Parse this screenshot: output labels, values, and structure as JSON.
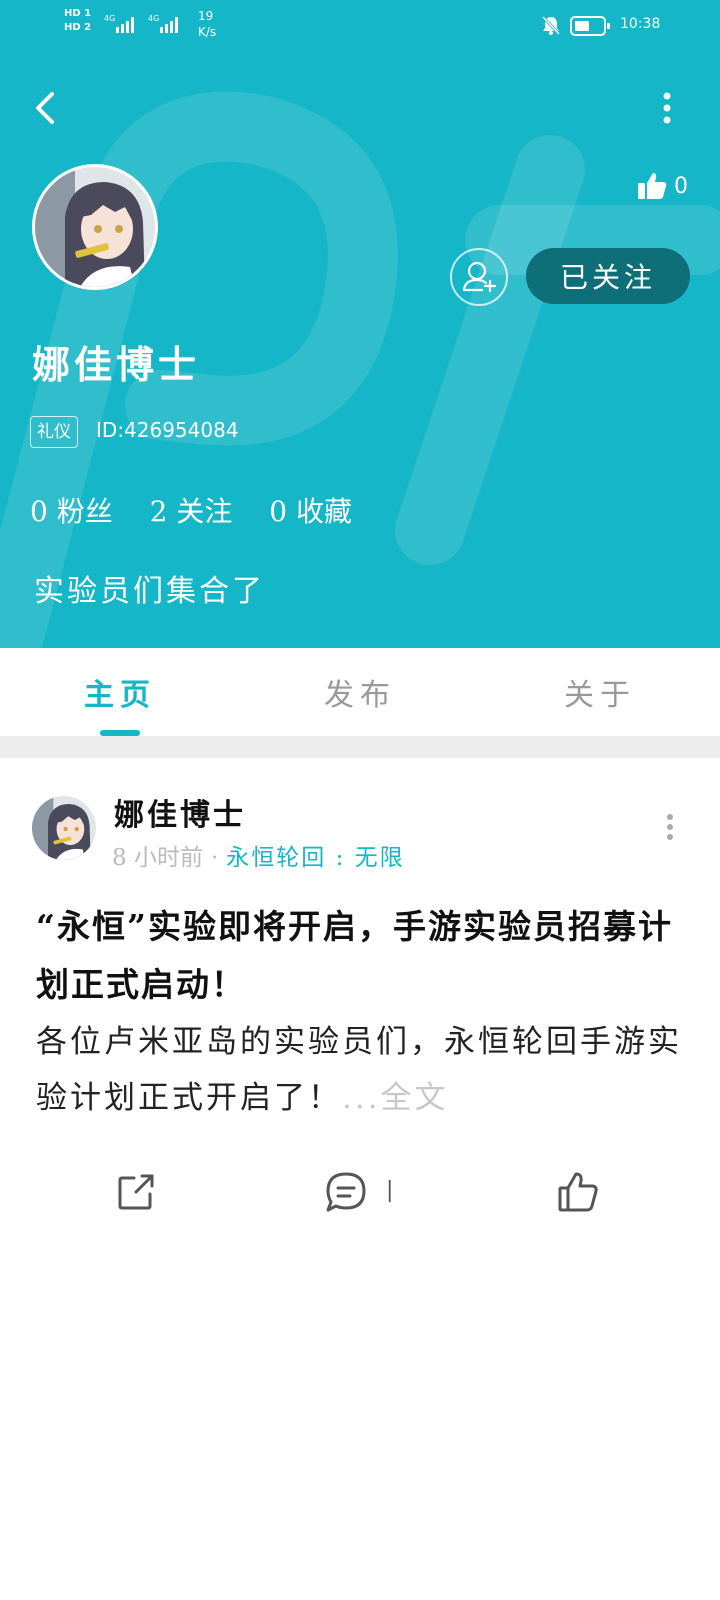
{
  "status_bar": {
    "network_1": "HD 1",
    "network_2": "HD 2",
    "signal_1": "4G",
    "signal_2": "4G",
    "speed_value": "19",
    "speed_unit": "K/s",
    "time": "10:38"
  },
  "profile": {
    "likes": "0",
    "follow_button": "已关注",
    "name": "娜佳博士",
    "tag": "礼仪",
    "id_text": "ID:426954084",
    "stats": {
      "fans": "0 粉丝",
      "following": "2 关注",
      "favorites": "0 收藏"
    },
    "bio": "实验员们集合了"
  },
  "tabs": [
    {
      "label": "主页",
      "active": true
    },
    {
      "label": "发布",
      "active": false
    },
    {
      "label": "关于",
      "active": false
    }
  ],
  "post": {
    "author": "娜佳博士",
    "time": "8 小时前",
    "separator": "·",
    "topic": "永恒轮回 : 无限",
    "title": "“永恒”实验即将开启，手游实验员招募计划正式启动！",
    "body": "各位卢米亚岛的实验员们，永恒轮回手游实验计划正式开启了！",
    "more_link": "...全文",
    "comment_count": "|"
  },
  "colors": {
    "accent": "#14b6c7",
    "follow_bg": "#0e6f79"
  }
}
